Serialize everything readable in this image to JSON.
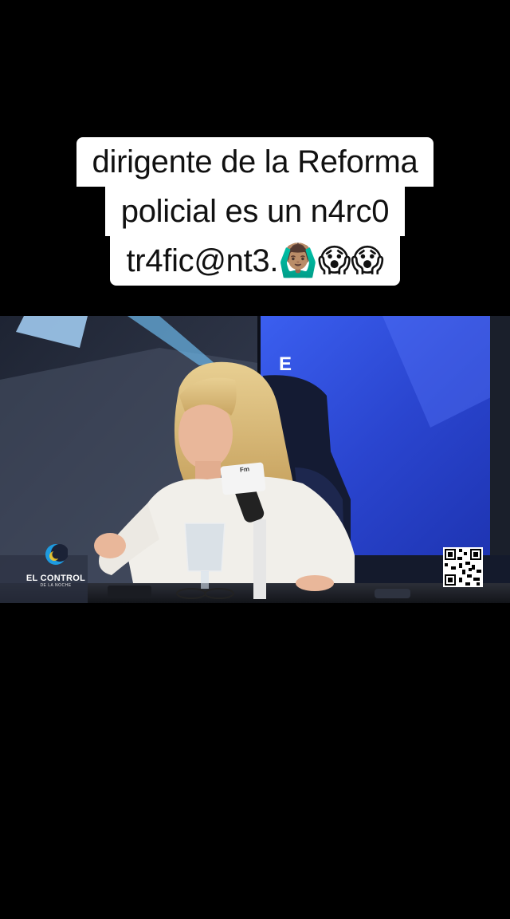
{
  "caption": {
    "lines": [
      "dirigente de la Reforma",
      "policial es un n4rc0",
      "tr4fic@nt3.🙆🏽‍♂️😱😱"
    ]
  },
  "video": {
    "set_letter": "E",
    "mic_flag_text": "Fm",
    "brand": {
      "name": "EL CONTROL",
      "subtitle": "DE LA NOCHE",
      "accent_color": "#1e9be0"
    }
  },
  "colors": {
    "background": "#000000",
    "caption_bg": "#ffffff",
    "caption_text": "#111111",
    "studio_blue": "#2d4fd6"
  }
}
